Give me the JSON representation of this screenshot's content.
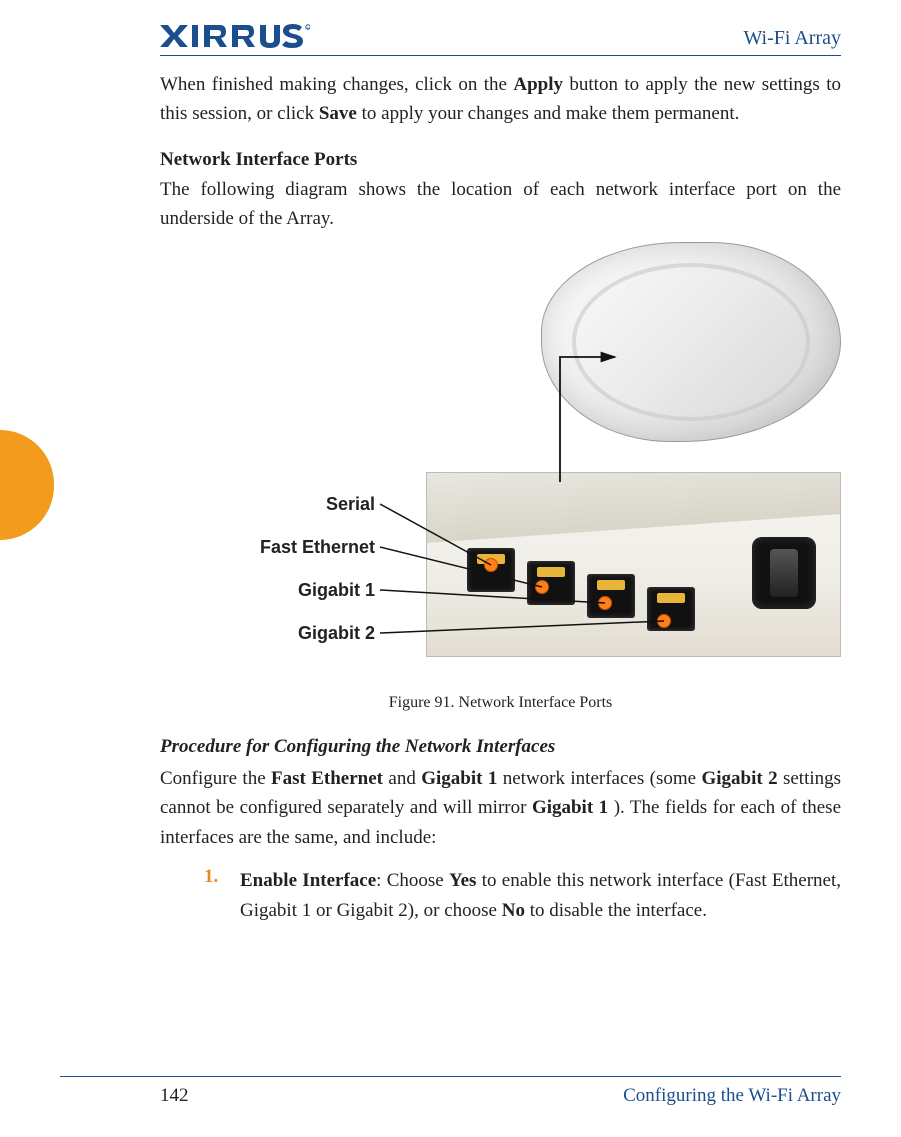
{
  "header": {
    "brand": "XIRRUS",
    "title": "Wi-Fi Array"
  },
  "intro": {
    "pre1": "When finished making changes, click on the ",
    "apply": "Apply",
    "mid1": " button to apply the new settings to this session, or click ",
    "save": "Save",
    "post1": " to apply your changes and make them permanent."
  },
  "section1": {
    "heading": "Network Interface Ports",
    "para": "The following diagram shows the location of each network interface port on the underside of the Array."
  },
  "figure": {
    "labels": {
      "serial": "Serial",
      "fast_eth": "Fast Ethernet",
      "gig1": "Gigabit 1",
      "gig2": "Gigabit 2"
    },
    "caption": "Figure 91. Network Interface Ports"
  },
  "section2": {
    "heading": "Procedure for Configuring the Network Interfaces",
    "p_pre": "Configure the ",
    "p_b1": "Fast Ethernet",
    "p_mid1": " and ",
    "p_b2": "Gigabit 1",
    "p_mid2": " network interfaces (some ",
    "p_b3": "Gigabit 2",
    "p_mid3": " settings cannot be configured separately and will mirror ",
    "p_b4": "Gigabit 1",
    "p_post": "). The fields for each of these interfaces are the same, and include:"
  },
  "list": {
    "num1": "1.",
    "i1_b1": "Enable Interface",
    "i1_t1": ": Choose ",
    "i1_b2": "Yes",
    "i1_t2": " to enable this network interface (Fast Ethernet, Gigabit 1 or Gigabit 2), or choose ",
    "i1_b3": "No",
    "i1_t3": " to disable the interface."
  },
  "footer": {
    "page": "142",
    "section": "Configuring the Wi-Fi Array"
  }
}
